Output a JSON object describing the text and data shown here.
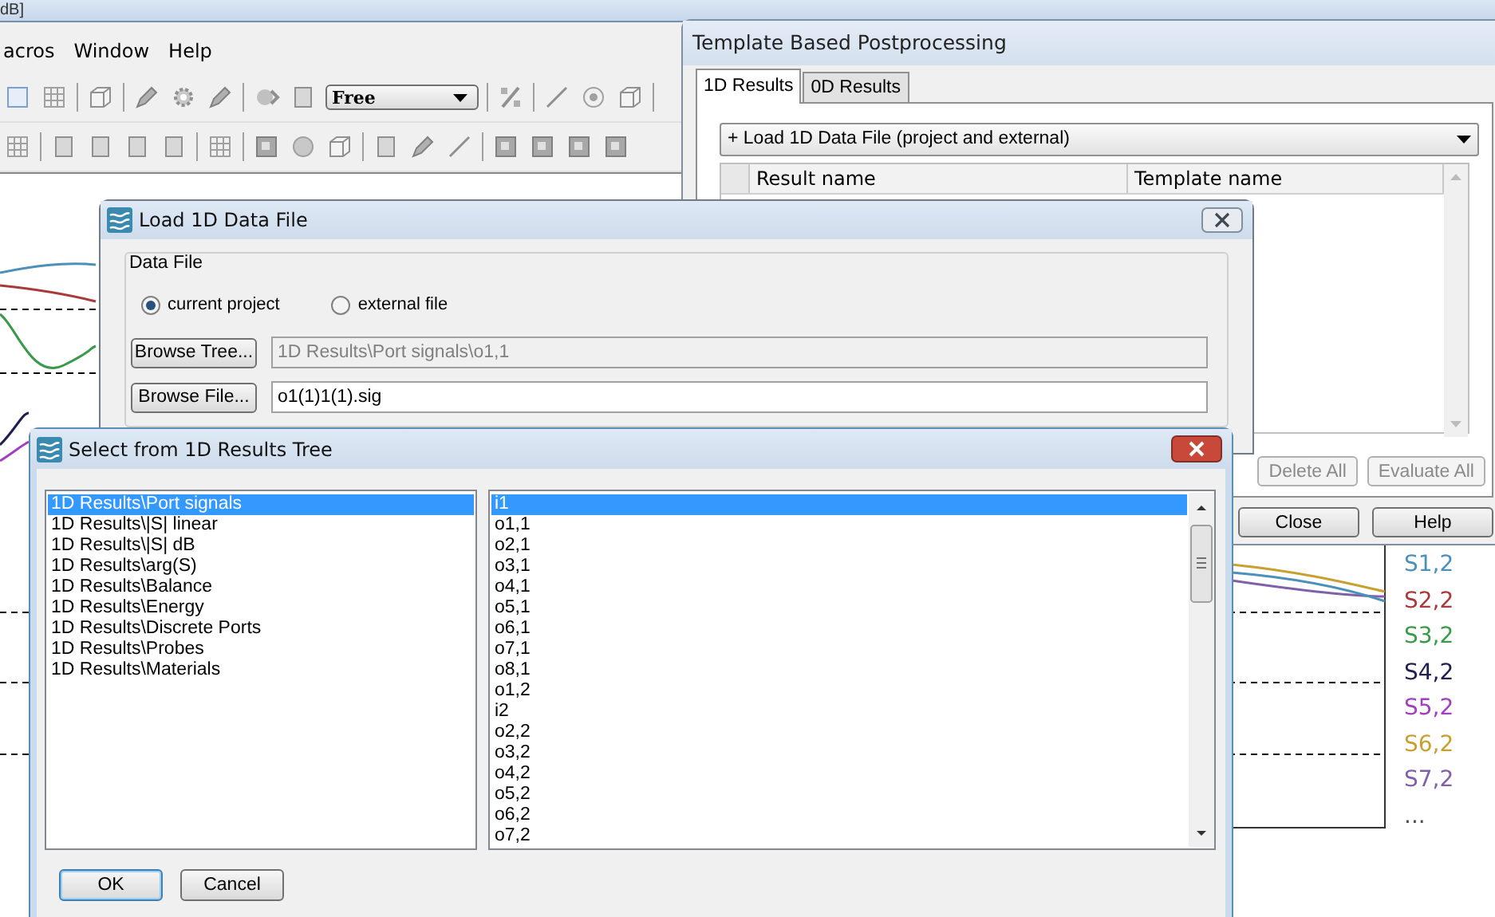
{
  "main_window": {
    "title": "dB]",
    "menu": [
      {
        "label": "acros"
      },
      {
        "label": "Window"
      },
      {
        "label": "Help"
      }
    ],
    "mode_dropdown": "Free",
    "legend": [
      {
        "label": "S1,2",
        "color": "#4a90b8"
      },
      {
        "label": "S2,2",
        "color": "#a83a3a"
      },
      {
        "label": "S3,2",
        "color": "#3a9a4a"
      },
      {
        "label": "S4,2",
        "color": "#202050"
      },
      {
        "label": "S5,2",
        "color": "#a040c0"
      },
      {
        "label": "S6,2",
        "color": "#c8a030"
      },
      {
        "label": "S7,2",
        "color": "#8060a8"
      },
      {
        "label": "...",
        "color": "#505050"
      }
    ]
  },
  "template_window": {
    "title": "Template Based Postprocessing",
    "tabs": [
      {
        "label": "1D Results",
        "selected": true
      },
      {
        "label": "0D Results",
        "selected": false
      }
    ],
    "action_dropdown": "+ Load 1D Data File (project and external)",
    "table": {
      "columns": [
        "Result name",
        "Template name"
      ]
    },
    "buttons": [
      {
        "label": "Delete All",
        "disabled": true
      },
      {
        "label": "Evaluate All",
        "disabled": true
      }
    ],
    "footer_buttons": [
      "Close",
      "Help"
    ]
  },
  "load_dialog": {
    "title": "Load 1D Data File",
    "group": "Data File",
    "sources": [
      {
        "label": "current project",
        "selected": true
      },
      {
        "label": "external file",
        "selected": false
      }
    ],
    "fields": [
      {
        "button": "Browse Tree...",
        "value": "1D Results\\Port signals\\o1,1",
        "disabled": true
      },
      {
        "button": "Browse File...",
        "value": "o1(1)1(1).sig",
        "disabled": false
      }
    ]
  },
  "select_dialog": {
    "title": "Select from 1D Results Tree",
    "folders": [
      {
        "label": "1D Results\\Port signals",
        "selected": true
      },
      {
        "label": "1D Results\\|S| linear",
        "selected": false
      },
      {
        "label": "1D Results\\|S| dB",
        "selected": false
      },
      {
        "label": "1D Results\\arg(S)",
        "selected": false
      },
      {
        "label": "1D Results\\Balance",
        "selected": false
      },
      {
        "label": "1D Results\\Energy",
        "selected": false
      },
      {
        "label": "1D Results\\Discrete Ports",
        "selected": false
      },
      {
        "label": "1D Results\\Probes",
        "selected": false
      },
      {
        "label": "1D Results\\Materials",
        "selected": false
      }
    ],
    "results": [
      {
        "label": "i1",
        "selected": true
      },
      {
        "label": "o1,1",
        "selected": false
      },
      {
        "label": "o2,1",
        "selected": false
      },
      {
        "label": "o3,1",
        "selected": false
      },
      {
        "label": "o4,1",
        "selected": false
      },
      {
        "label": "o5,1",
        "selected": false
      },
      {
        "label": "o6,1",
        "selected": false
      },
      {
        "label": "o7,1",
        "selected": false
      },
      {
        "label": "o8,1",
        "selected": false
      },
      {
        "label": "o1,2",
        "selected": false
      },
      {
        "label": "i2",
        "selected": false
      },
      {
        "label": "o2,2",
        "selected": false
      },
      {
        "label": "o3,2",
        "selected": false
      },
      {
        "label": "o4,2",
        "selected": false
      },
      {
        "label": "o5,2",
        "selected": false
      },
      {
        "label": "o6,2",
        "selected": false
      },
      {
        "label": "o7,2",
        "selected": false
      }
    ],
    "buttons": [
      "OK",
      "Cancel"
    ]
  }
}
